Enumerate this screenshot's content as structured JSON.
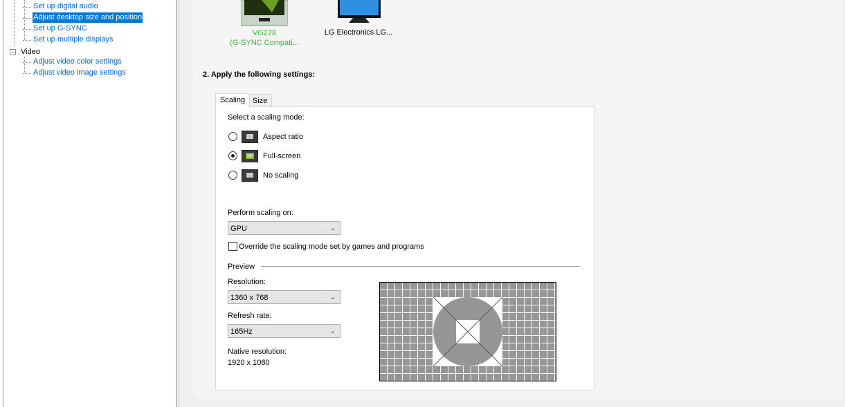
{
  "tree": {
    "items": [
      {
        "label": "Set up digital audio",
        "selected": false
      },
      {
        "label": "Adjust desktop size and position",
        "selected": true
      },
      {
        "label": "Set up G-SYNC",
        "selected": false
      },
      {
        "label": "Set up multiple displays",
        "selected": false
      }
    ],
    "video": {
      "label": "Video",
      "items": [
        "Adjust video color settings",
        "Adjust video image settings"
      ]
    }
  },
  "displays": [
    {
      "name": "VG278",
      "sub": "(G-SYNC Compati...",
      "selected": true
    },
    {
      "name": "LG Electronics LG...",
      "selected": false
    }
  ],
  "section_title": "2. Apply the following settings:",
  "tabs": [
    "Scaling",
    "Size"
  ],
  "scaling": {
    "prompt": "Select a scaling mode:",
    "modes": [
      {
        "label": "Aspect ratio",
        "checked": false
      },
      {
        "label": "Full-screen",
        "checked": true
      },
      {
        "label": "No scaling",
        "checked": false
      }
    ],
    "perform_label": "Perform scaling on:",
    "perform_value": "GPU",
    "override_label": "Override the scaling mode set by games and programs",
    "override_checked": false,
    "preview_label": "Preview",
    "resolution_label": "Resolution:",
    "resolution_value": "1360 x 768",
    "refresh_label": "Refresh rate:",
    "refresh_value": "165Hz",
    "native_label": "Native resolution:",
    "native_value": "1920 x 1080"
  },
  "colors": {
    "accent": "#0078d7",
    "link": "#0066cc",
    "nvidia_green": "#3cb43c"
  }
}
